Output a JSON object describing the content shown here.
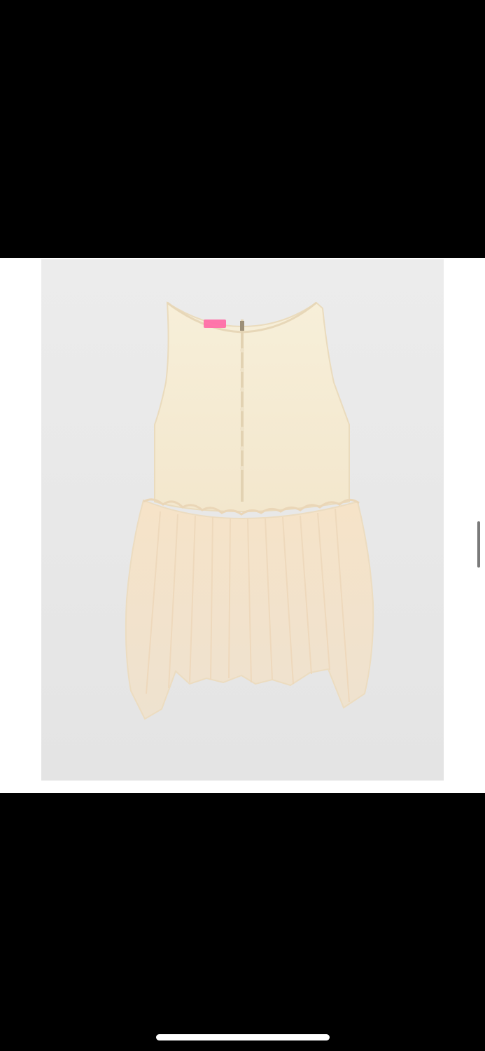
{
  "screen": {
    "background": "#000000",
    "media_band_color": "#ffffff"
  },
  "photo": {
    "subject": "dress-image",
    "garment_color": "#f6ecd6",
    "label_color": "#ff6fa8"
  },
  "system": {
    "home_indicator_color": "#ffffff",
    "scroll_indicator_color": "#7a7a7a"
  }
}
